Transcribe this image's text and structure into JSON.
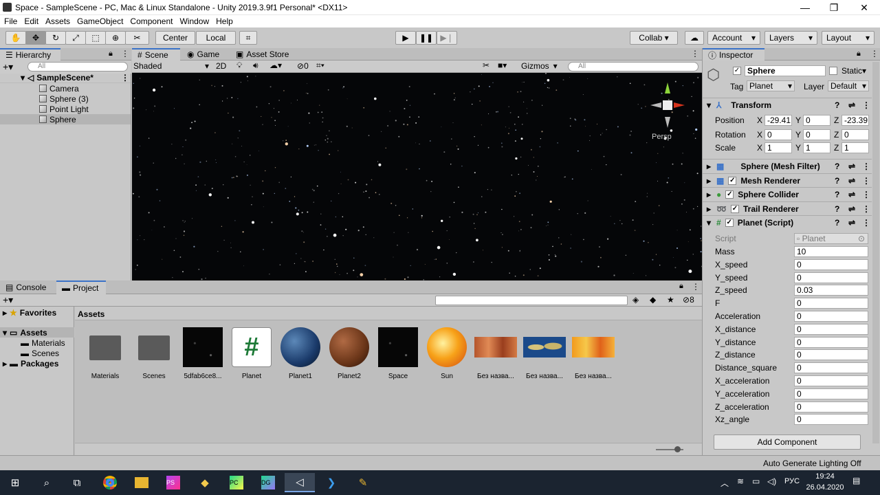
{
  "window": {
    "title": "Space - SampleScene - PC, Mac & Linux Standalone - Unity 2019.3.9f1 Personal* <DX11>",
    "minimize": "—",
    "maximize": "❐",
    "close": "✕"
  },
  "menu": [
    "File",
    "Edit",
    "Assets",
    "GameObject",
    "Component",
    "Window",
    "Help"
  ],
  "toolbar": {
    "center": "Center",
    "local": "Local",
    "collab": "Collab ▾",
    "account": "Account",
    "layers": "Layers",
    "layout": "Layout"
  },
  "hierarchy": {
    "tab": "Hierarchy",
    "search": "All",
    "scene": "SampleScene*",
    "items": [
      "Camera",
      "Sphere (3)",
      "Point Light",
      "Sphere"
    ]
  },
  "scene_panel": {
    "tabs": [
      "Scene",
      "Game",
      "Asset Store"
    ],
    "shading": "Shaded",
    "mode2d": "2D",
    "hidden_count": "0",
    "gizmos": "Gizmos",
    "search": "All",
    "persp": "Persp"
  },
  "bottom": {
    "tabs": [
      "Console",
      "Project"
    ],
    "count": "8",
    "favorites": "Favorites",
    "assets_root": "Assets",
    "folders": [
      "Materials",
      "Scenes"
    ],
    "packages": "Packages",
    "breadcrumb": "Assets"
  },
  "assets": [
    {
      "name": "Materials",
      "kind": "folder"
    },
    {
      "name": "Scenes",
      "kind": "folder"
    },
    {
      "name": "5dfab6ce8...",
      "kind": "stars"
    },
    {
      "name": "Planet",
      "kind": "script"
    },
    {
      "name": "Planet1",
      "kind": "earth"
    },
    {
      "name": "Planet2",
      "kind": "mars"
    },
    {
      "name": "Space",
      "kind": "stars"
    },
    {
      "name": "Sun",
      "kind": "sun"
    },
    {
      "name": "Без назва...",
      "kind": "tex-mars"
    },
    {
      "name": "Без назва...",
      "kind": "tex-earth"
    },
    {
      "name": "Без назва...",
      "kind": "tex-sun"
    }
  ],
  "inspector": {
    "tab": "Inspector",
    "object_name": "Sphere",
    "static": "Static",
    "tag_label": "Tag",
    "tag": "Planet",
    "layer_label": "Layer",
    "layer": "Default",
    "transform": {
      "title": "Transform",
      "rows": [
        {
          "label": "Position",
          "x": "-29.41",
          "y": "0",
          "z": "-23.39"
        },
        {
          "label": "Rotation",
          "x": "0",
          "y": "0",
          "z": "0"
        },
        {
          "label": "Scale",
          "x": "1",
          "y": "1",
          "z": "1"
        }
      ]
    },
    "components": [
      "Sphere (Mesh Filter)",
      "Mesh Renderer",
      "Sphere Collider",
      "Trail Renderer",
      "Planet (Script)"
    ],
    "script_label": "Script",
    "script_value": "Planet",
    "fields": [
      {
        "label": "Mass",
        "value": "10"
      },
      {
        "label": "X_speed",
        "value": "0"
      },
      {
        "label": "Y_speed",
        "value": "0"
      },
      {
        "label": "Z_speed",
        "value": "0.03"
      },
      {
        "label": "F",
        "value": "0"
      },
      {
        "label": "Acceleration",
        "value": "0"
      },
      {
        "label": "X_distance",
        "value": "0"
      },
      {
        "label": "Y_distance",
        "value": "0"
      },
      {
        "label": "Z_distance",
        "value": "0"
      },
      {
        "label": "Distance_square",
        "value": "0"
      },
      {
        "label": "X_acceleration",
        "value": "0"
      },
      {
        "label": "Y_acceleration",
        "value": "0"
      },
      {
        "label": "Z_acceleration",
        "value": "0"
      },
      {
        "label": "Xz_angle",
        "value": "0"
      }
    ],
    "add_component": "Add Component"
  },
  "status": {
    "text": "Auto Generate Lighting Off"
  },
  "taskbar": {
    "lang": "РУС",
    "time": "19:24",
    "date": "26.04.2020"
  }
}
